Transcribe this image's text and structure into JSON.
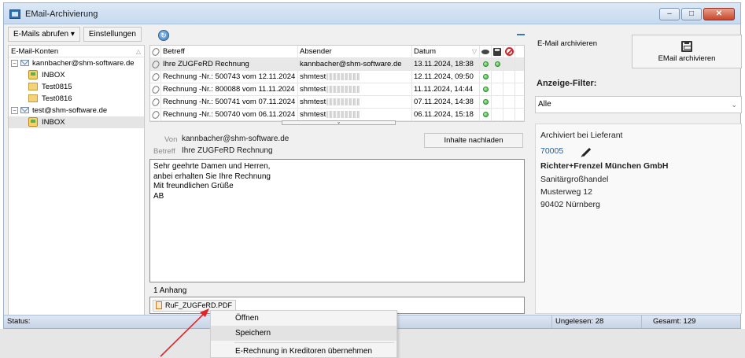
{
  "window": {
    "title": "EMail-Archivierung"
  },
  "toolbar": {
    "fetch_label": "E-Mails abrufen",
    "fetch_chevron": "▾",
    "settings_label": "Einstellungen"
  },
  "accounts": {
    "header": "E-Mail-Konten",
    "items": [
      {
        "label": "kannbacher@shm-software.de",
        "type": "account",
        "expander": "⊟"
      },
      {
        "label": "INBOX",
        "type": "inbox"
      },
      {
        "label": "Test0815",
        "type": "folder"
      },
      {
        "label": "Test0816",
        "type": "folder"
      },
      {
        "label": "test@shm-software.de",
        "type": "account",
        "expander": "⊟"
      },
      {
        "label": "INBOX",
        "type": "inbox",
        "selected": true
      }
    ]
  },
  "mail_table": {
    "columns": {
      "subject": "Betreff",
      "sender": "Absender",
      "date": "Datum"
    },
    "rows": [
      {
        "subject": "Ihre ZUGFeRD Rechnung",
        "sender": "kannbacher@shm-software.de",
        "date": "13.11.2024, 18:38",
        "selected": true
      },
      {
        "subject": "Rechnung -Nr.: 500743 vom 12.11.2024",
        "sender": "shmtest",
        "date": "12.11.2024, 09:50"
      },
      {
        "subject": "Rechnung -Nr.: 800088 vom 11.11.2024",
        "sender": "shmtest",
        "date": "11.11.2024, 14:44"
      },
      {
        "subject": "Rechnung -Nr.: 500741 vom 07.11.2024",
        "sender": "shmtest",
        "date": "07.11.2024, 14:38"
      },
      {
        "subject": "Rechnung -Nr.: 500740 vom 06.11.2024",
        "sender": "shmtest",
        "date": "06.11.2024, 15:18"
      }
    ]
  },
  "preview": {
    "from_label": "Von",
    "from_value": "kannbacher@shm-software.de",
    "subject_label": "Betreff",
    "subject_value": "Ihre ZUGFeRD Rechnung",
    "reload_label": "Inhalte nachladen",
    "body_lines": [
      "Sehr geehrte Damen und Herren,",
      "",
      "anbei erhalten Sie Ihre Rechnung",
      "",
      "Mit freundlichen Grüße",
      "AB"
    ]
  },
  "attachments": {
    "count_label": "1 Anhang",
    "file_name": "RuF_ZUGFeRD.PDF"
  },
  "context_menu": {
    "items": [
      "Öffnen",
      "Speichern",
      "E-Rechnung in Kreditoren übernehmen"
    ]
  },
  "right_panel": {
    "archive_label": "E-Mail archivieren",
    "archive_button": "EMail archivieren",
    "filter_title": "Anzeige-Filter:",
    "filter_value": "Alle",
    "supplier_caption": "Archiviert bei Lieferant",
    "supplier_id": "70005",
    "supplier_name": "Richter+Frenzel München GmbH",
    "supplier_line2": "Sanitärgroßhandel",
    "supplier_street": "Musterweg 12",
    "supplier_city": "90402 Nürnberg"
  },
  "statusbar": {
    "status_label": "Status:",
    "unread": "Ungelesen: 28",
    "total": "Gesamt: 129"
  },
  "colors": {
    "accent": "#1f5fb0",
    "arrow": "#e0262b",
    "status_ok": "#38a83a"
  },
  "icons": [
    "app-icon",
    "refresh-icon",
    "envelope-icon",
    "inbox-icon",
    "folder-icon",
    "paperclip-icon",
    "eye-icon",
    "disk-icon",
    "no-entry-icon",
    "pdf-icon",
    "save-icon",
    "pencil-icon",
    "chevron-down-icon"
  ]
}
